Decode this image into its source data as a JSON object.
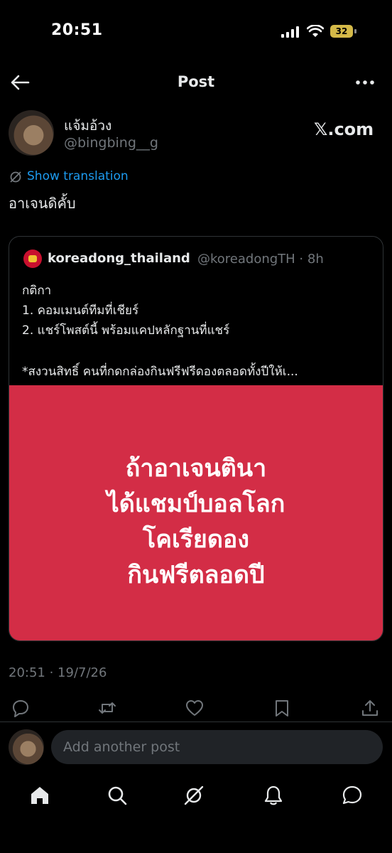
{
  "status_bar": {
    "time": "20:51",
    "battery": "32"
  },
  "header": {
    "title": "Post"
  },
  "post": {
    "display_name": "แจ้มอ้วง",
    "username": "@bingbing__g",
    "watermark": "𝕏.com",
    "show_translation": "Show translation",
    "text": "อาเจนดิคั้บ",
    "timestamp": "20:51 · 19/7/26"
  },
  "quote": {
    "name": "koreadong_thailand",
    "handle_time": "@koreadongTH · 8h",
    "lines": [
      "กติกา",
      "1. คอมเมนต์ทีมที่เชียร์",
      "2. แชร์โพสต์นี้ พร้อมแคปหลักฐานที่แชร์",
      "*สงวนสิทธิ์ คนที่กดกล่องกินฟรีฟรีดองตลอดทั้งปีให้เ..."
    ],
    "image_lines": [
      "ถ้าอาเจนตินา",
      "ได้แชมป์บอลโลก",
      "โคเรียดอง",
      "กินฟรีตลอดปี"
    ],
    "image_bg": "#d32d46"
  },
  "reply": {
    "placeholder": "Add another post"
  },
  "colors": {
    "accent": "#1d9bf0",
    "muted": "#71767b",
    "background": "#000000"
  },
  "actions": [
    "reply-icon",
    "repost-icon",
    "like-icon",
    "bookmark-icon",
    "share-icon"
  ],
  "bottom_nav": [
    "home-icon",
    "search-icon",
    "grok-icon",
    "notifications-icon",
    "messages-icon"
  ]
}
